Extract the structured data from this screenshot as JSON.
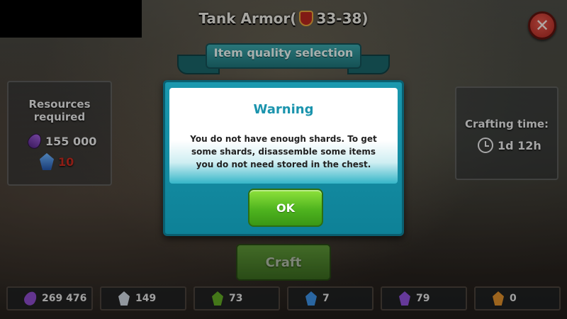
{
  "header": {
    "title_pre": "Tank Armor(",
    "title_post": "33-38)",
    "title_icon": "shield-icon",
    "close_icon": "close-icon"
  },
  "banner": {
    "text": "Item quality selection"
  },
  "resources": {
    "title_line1": "Resources",
    "title_line2": "required",
    "essence": {
      "value": "155 000",
      "icon": "essence-drop-icon",
      "color": "#7a3fb3"
    },
    "crystal": {
      "value": "10",
      "icon": "blue-crystal-icon",
      "color": "#c42a1f"
    }
  },
  "crafting": {
    "title": "Crafting time:",
    "time": "1d 12h",
    "icon": "clock-icon"
  },
  "craft_button": {
    "label": "Craft"
  },
  "modal": {
    "title": "Warning",
    "message": "You do not have enough shards. To get some shards, disassemble some items you do not need stored in the chest.",
    "ok_label": "OK"
  },
  "inventory": [
    {
      "name": "essence",
      "value": "269 476",
      "icon": "essence-drop-icon",
      "color": "#8a4ac6"
    },
    {
      "name": "white-shard",
      "value": "149",
      "icon": "white-shard-icon",
      "color": "#c9d2db"
    },
    {
      "name": "green-shard",
      "value": "73",
      "icon": "green-shard-icon",
      "color": "#5fa623"
    },
    {
      "name": "blue-shard",
      "value": "7",
      "icon": "blue-shard-icon",
      "color": "#3b8ee0"
    },
    {
      "name": "purple-shard",
      "value": "79",
      "icon": "purple-shard-icon",
      "color": "#8d4fd6"
    },
    {
      "name": "orange-shard",
      "value": "0",
      "icon": "orange-shard-icon",
      "color": "#d98b2a"
    }
  ]
}
